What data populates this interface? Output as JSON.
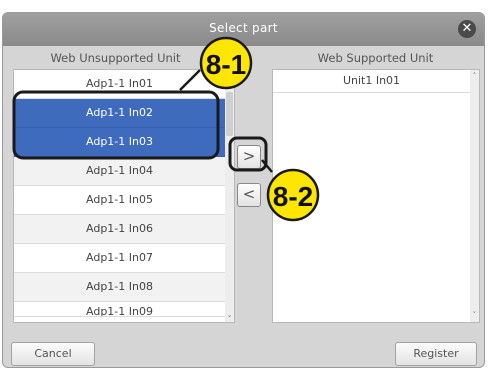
{
  "dialog": {
    "title": "Select part",
    "close_icon": "close-icon"
  },
  "left_list": {
    "header": "Web Unsupported Unit",
    "items": [
      {
        "label": "Adp1-1 In01",
        "selected": false
      },
      {
        "label": "Adp1-1 In02",
        "selected": true
      },
      {
        "label": "Adp1-1 In03",
        "selected": true
      },
      {
        "label": "Adp1-1 In04",
        "selected": false
      },
      {
        "label": "Adp1-1 In05",
        "selected": false
      },
      {
        "label": "Adp1-1 In06",
        "selected": false
      },
      {
        "label": "Adp1-1 In07",
        "selected": false
      },
      {
        "label": "Adp1-1 In08",
        "selected": false
      },
      {
        "label": "Adp1-1 In09",
        "selected": false
      }
    ]
  },
  "right_list": {
    "header": "Web Supported Unit",
    "items": [
      {
        "label": "Unit1 In01"
      }
    ]
  },
  "buttons": {
    "move_right": ">",
    "move_left": "<",
    "cancel": "Cancel",
    "register": "Register"
  },
  "annotations": {
    "step1": "8-1",
    "step2": "8-2"
  },
  "colors": {
    "selection": "#3f6bbf",
    "callout_fill": "#ffe600",
    "titlebar": "#8f8f8f"
  }
}
